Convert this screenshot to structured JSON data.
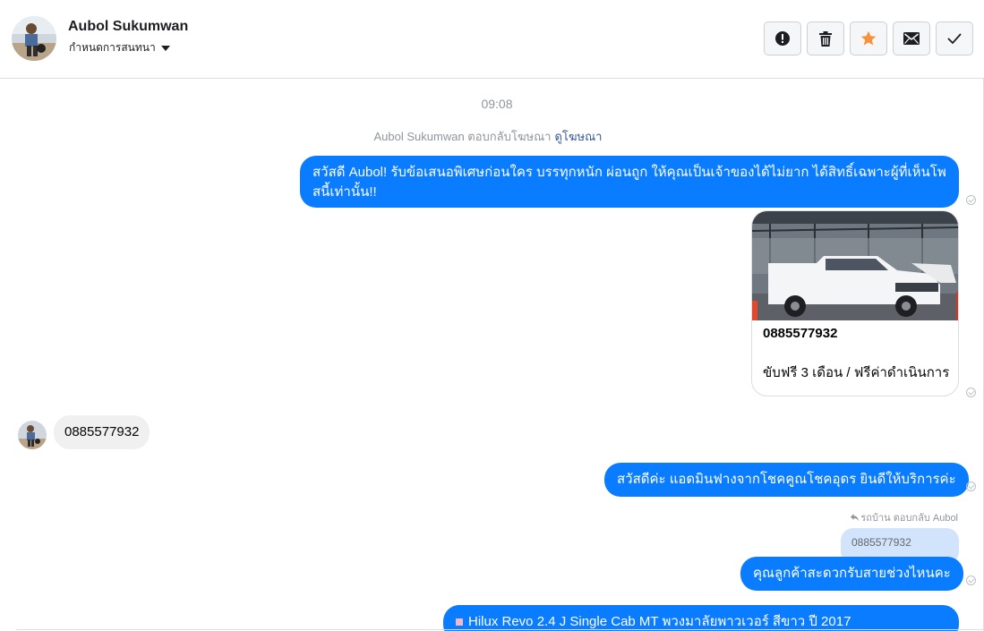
{
  "header": {
    "name": "Aubol Sukumwan",
    "assign_label": "กำหนดการสนทนา"
  },
  "toolbar": {
    "icons": [
      "alert-icon",
      "trash-icon",
      "star-icon",
      "mail-icon",
      "check-icon"
    ],
    "star_color": "#f7923a"
  },
  "thread": {
    "time": "09:08",
    "system_text": "Aubol Sukumwan ตอบกลับโฆษณา",
    "system_link": "ดูโฆษณา",
    "msg1": "สวัสดี Aubol! รับข้อเสนอพิเศษก่อนใคร บรรทุกหนัก ผ่อนถูก ให้คุณเป็นเจ้าของได้ไม่ยาก ได้สิทธิ์เฉพาะผู้ที่เห็นโพสนี้เท่านั้น!!",
    "card_title": "0885577932",
    "card_subtitle": "ขับฟรี 3 เดือน / ฟรีค่าดำเนินการ",
    "incoming": "0885577932",
    "msg2": "สวัสดีค่ะ แอดมินฟางจากโชคคูณโชคอุดร ยินดีให้บริการค่ะ",
    "reply_meta": "รถบ้าน ตอบกลับ Aubol",
    "reply_quote": "0885577932",
    "msg3": "คุณลูกค้าสะดวกรับสายช่วงไหนคะ",
    "msg4": "Hilux Revo 2.4 J Single Cab MT พวงมาลัยพาวเวอร์ สีขาว ปี 2017"
  },
  "colors": {
    "accent": "#0a7cff",
    "incoming_bg": "#f0f0f0",
    "quote_bg": "#d2e3fc"
  }
}
